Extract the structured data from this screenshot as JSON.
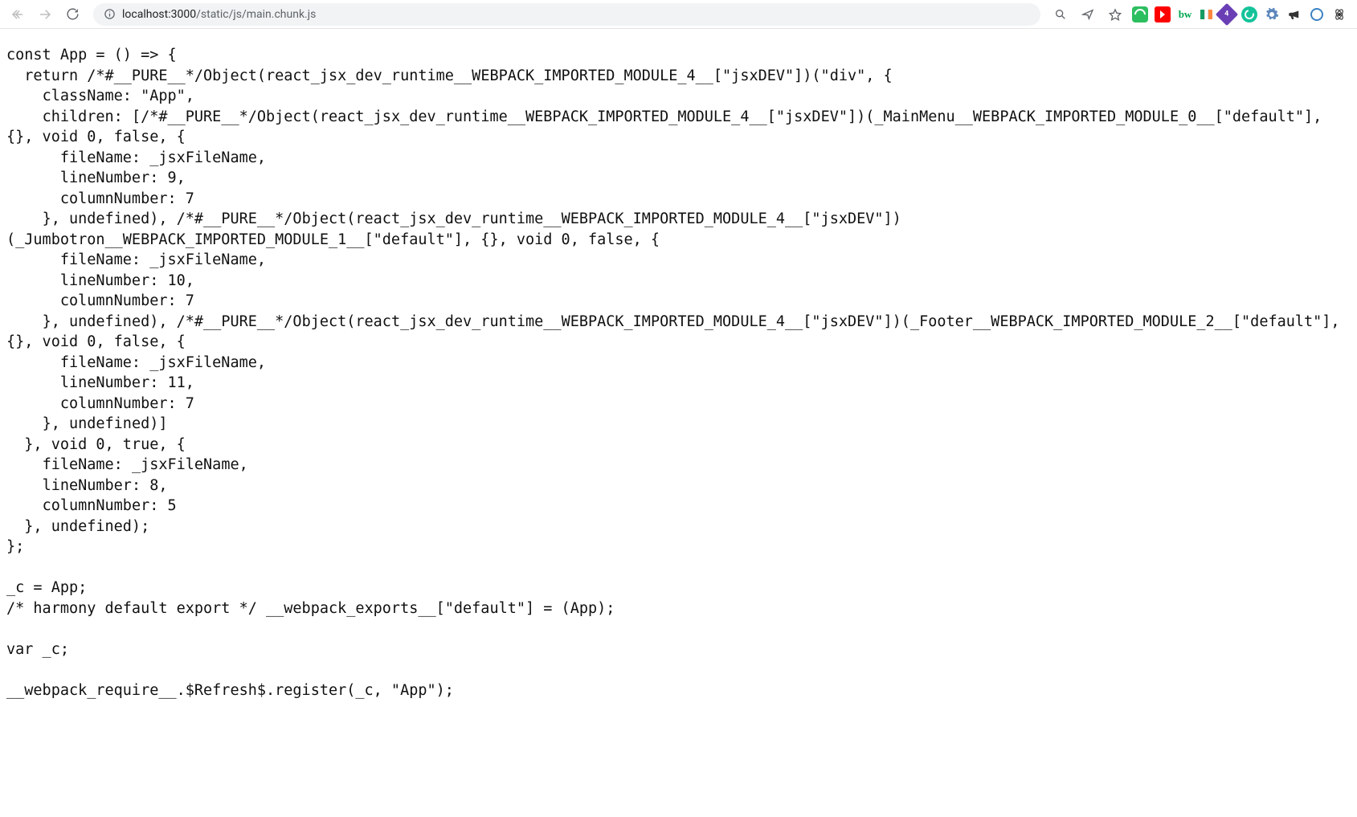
{
  "url": {
    "host": "localhost:3000",
    "path": "/static/js/main.chunk.js"
  },
  "extensions": {
    "bw": "bw",
    "purple_badge": "4"
  },
  "code": "const App = () => {\n  return /*#__PURE__*/Object(react_jsx_dev_runtime__WEBPACK_IMPORTED_MODULE_4__[\"jsxDEV\"])(\"div\", {\n    className: \"App\",\n    children: [/*#__PURE__*/Object(react_jsx_dev_runtime__WEBPACK_IMPORTED_MODULE_4__[\"jsxDEV\"])(_MainMenu__WEBPACK_IMPORTED_MODULE_0__[\"default\"], {}, void 0, false, {\n      fileName: _jsxFileName,\n      lineNumber: 9,\n      columnNumber: 7\n    }, undefined), /*#__PURE__*/Object(react_jsx_dev_runtime__WEBPACK_IMPORTED_MODULE_4__[\"jsxDEV\"])(_Jumbotron__WEBPACK_IMPORTED_MODULE_1__[\"default\"], {}, void 0, false, {\n      fileName: _jsxFileName,\n      lineNumber: 10,\n      columnNumber: 7\n    }, undefined), /*#__PURE__*/Object(react_jsx_dev_runtime__WEBPACK_IMPORTED_MODULE_4__[\"jsxDEV\"])(_Footer__WEBPACK_IMPORTED_MODULE_2__[\"default\"], {}, void 0, false, {\n      fileName: _jsxFileName,\n      lineNumber: 11,\n      columnNumber: 7\n    }, undefined)]\n  }, void 0, true, {\n    fileName: _jsxFileName,\n    lineNumber: 8,\n    columnNumber: 5\n  }, undefined);\n};\n\n_c = App;\n/* harmony default export */ __webpack_exports__[\"default\"] = (App);\n\nvar _c;\n\n__webpack_require__.$Refresh$.register(_c, \"App\");"
}
